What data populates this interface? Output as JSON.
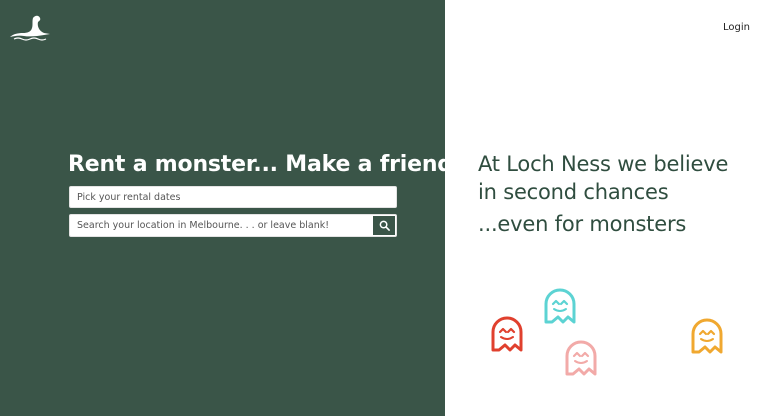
{
  "header": {
    "logo_icon": "loch-ness-monster-icon",
    "login_label": "Login"
  },
  "hero": {
    "headline": "Rent a monster... Make a friend",
    "date_placeholder": "Pick your rental dates",
    "location_placeholder": "Search your location in Melbourne. . . or leave blank!",
    "search_icon": "search-icon"
  },
  "tagline": {
    "line1": "At Loch Ness we believe",
    "line2": "in second chances",
    "line3": "...even for monsters"
  },
  "ghosts": [
    {
      "color": "#e0402e"
    },
    {
      "color": "#5cd3d3"
    },
    {
      "color": "#f2aaa8"
    },
    {
      "color": "#f0a830"
    }
  ],
  "colors": {
    "panel_green": "#3a5548",
    "tagline_green": "#2f4d3f"
  }
}
